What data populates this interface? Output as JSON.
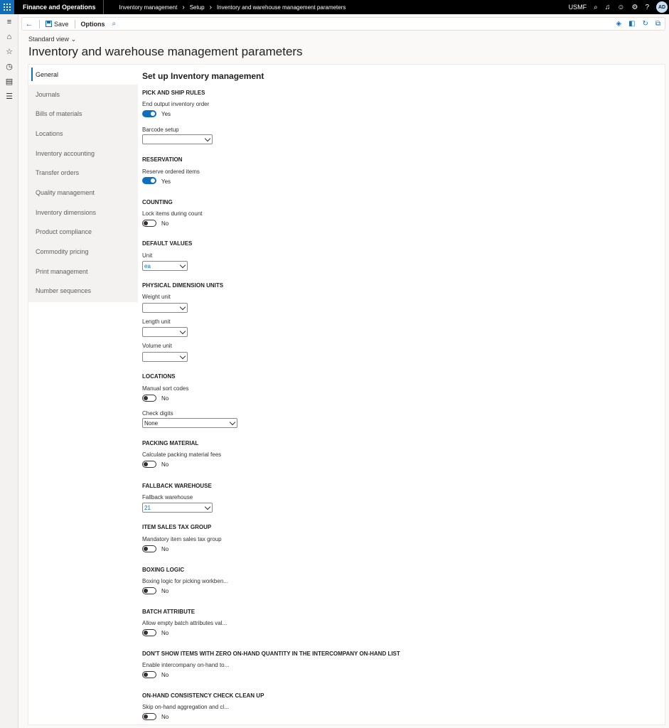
{
  "topbar": {
    "app_title": "Finance and Operations",
    "breadcrumbs": [
      "Inventory management",
      "Setup",
      "Inventory and warehouse management parameters"
    ],
    "company": "USMF",
    "avatar": "AD",
    "icons": [
      "search-icon",
      "bell-icon",
      "smiley-icon",
      "gear-icon",
      "help-icon"
    ]
  },
  "rail": {
    "icons": [
      "hamburger-icon",
      "home-icon",
      "star-icon",
      "recent-icon",
      "workspace-icon",
      "modules-icon"
    ]
  },
  "actionbar": {
    "save_label": "Save",
    "options_label": "Options"
  },
  "page": {
    "view_label": "Standard view",
    "title": "Inventory and warehouse management parameters"
  },
  "nav": {
    "items": [
      {
        "label": "General",
        "active": true
      },
      {
        "label": "Journals"
      },
      {
        "label": "Bills of materials"
      },
      {
        "label": "Locations"
      },
      {
        "label": "Inventory accounting"
      },
      {
        "label": "Transfer orders"
      },
      {
        "label": "Quality management"
      },
      {
        "label": "Inventory dimensions"
      },
      {
        "label": "Product compliance"
      },
      {
        "label": "Commodity pricing"
      },
      {
        "label": "Print management"
      },
      {
        "label": "Number sequences"
      }
    ]
  },
  "form": {
    "title": "Set up Inventory management",
    "pick_ship": {
      "header": "PICK AND SHIP RULES",
      "end_output_label": "End output inventory order",
      "end_output_value": "Yes",
      "barcode_label": "Barcode setup",
      "barcode_value": ""
    },
    "reservation": {
      "header": "RESERVATION",
      "reserve_label": "Reserve ordered items",
      "reserve_value": "Yes"
    },
    "counting": {
      "header": "COUNTING",
      "lock_label": "Lock items during count",
      "lock_value": "No"
    },
    "default_values": {
      "header": "DEFAULT VALUES",
      "unit_label": "Unit",
      "unit_value": "ea"
    },
    "physical_units": {
      "header": "PHYSICAL DIMENSION UNITS",
      "weight_label": "Weight unit",
      "weight_value": "",
      "length_label": "Length unit",
      "length_value": "",
      "volume_label": "Volume unit",
      "volume_value": ""
    },
    "locations": {
      "header": "LOCATIONS",
      "manual_sort_label": "Manual sort codes",
      "manual_sort_value": "No",
      "check_digits_label": "Check digits",
      "check_digits_value": "None"
    },
    "packing": {
      "header": "PACKING MATERIAL",
      "calc_label": "Calculate packing material fees",
      "calc_value": "No"
    },
    "fallback": {
      "header": "FALLBACK WAREHOUSE",
      "warehouse_label": "Fallback warehouse",
      "warehouse_value": "21"
    },
    "item_sales_tax": {
      "header": "ITEM SALES TAX GROUP",
      "mandatory_label": "Mandatory item sales tax group",
      "mandatory_value": "No"
    },
    "boxing": {
      "header": "BOXING LOGIC",
      "boxing_label": "Boxing logic for picking workben...",
      "boxing_value": "No"
    },
    "batch": {
      "header": "BATCH ATTRIBUTE",
      "allow_label": "Allow empty batch attributes val...",
      "allow_value": "No"
    },
    "intercompany": {
      "header": "DON'T SHOW ITEMS WITH ZERO ON-HAND QUANTITY IN THE INTERCOMPANY ON-HAND LIST",
      "enable_label": "Enable intercompany on-hand to...",
      "enable_value": "No"
    },
    "onhand": {
      "header": "ON-HAND CONSISTENCY CHECK CLEAN UP",
      "skip_label": "Skip on-hand aggregation and cl...",
      "skip_value": "No"
    }
  },
  "colors": {
    "accent": "#106ebe",
    "topbar": "#000000"
  }
}
